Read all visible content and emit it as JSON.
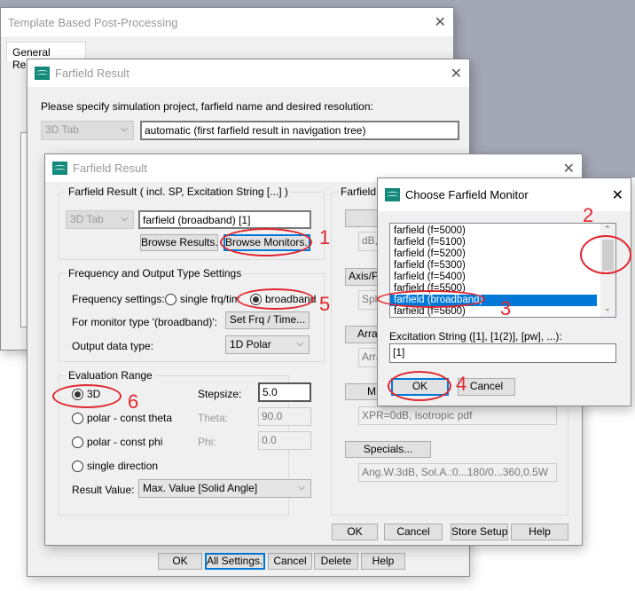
{
  "template_window": {
    "title": "Template Based Post-Processing",
    "tab": "General Results"
  },
  "farfield_back": {
    "title": "Farfield Result",
    "instruction": "Please specify simulation project, farfield name and desired resolution:",
    "combo": "3D Tab",
    "result_input": "automatic (first farfield result in navigation tree)",
    "buttons": {
      "ok": "OK",
      "all_settings": "All Settings...",
      "cancel": "Cancel",
      "delete": "Delete",
      "help": "Help"
    }
  },
  "farfield_front": {
    "title": "Farfield Result",
    "result_group": {
      "legend": "Farfield Result ( incl. SP, Excitation String [...] )",
      "combo": "3D Tab",
      "input": "farfield (broadband) [1]",
      "browse_results": "Browse Results...",
      "browse_monitors": "Browse Monitors..."
    },
    "freq_group": {
      "legend": "Frequency and Output Type Settings",
      "freq_label": "Frequency settings:",
      "radio_single": "single frq/time",
      "radio_broadband": "broadband",
      "monitor_type_label": "For monitor type '(broadband)':",
      "set_frq": "Set Frq / Time...",
      "output_label": "Output data type:",
      "output_value": "1D Polar"
    },
    "eval_group": {
      "legend": "Evaluation Range",
      "radio_3d": "3D",
      "radio_theta": "polar - const theta",
      "radio_phi": "polar - const phi",
      "radio_single": "single direction",
      "stepsize_label": "Stepsize:",
      "stepsize": "5.0",
      "theta_label": "Theta:",
      "theta": "90.0",
      "phi_label": "Phi:",
      "phi": "0.0",
      "result_value_label": "Result Value:",
      "result_value": "Max. Value [Solid Angle]"
    },
    "settings_group": {
      "legend": "Farfield S",
      "plot": "Plo",
      "plot_value": "dB,F",
      "axis": "Axis/P",
      "axis_value": "Sph",
      "array": "Arra",
      "array_value": "Arra",
      "m_button": "M",
      "xpr_value": "XPR=0dB, isotropic pdf",
      "specials": "Specials...",
      "specials_value": "Ang.W.3dB, Sol.A.:0...180/0...360,0.5W"
    },
    "buttons": {
      "ok": "OK",
      "cancel": "Cancel",
      "store_setup": "Store Setup",
      "help": "Help"
    }
  },
  "chooser": {
    "title": "Choose Farfield Monitor",
    "items": [
      "farfield (f=5000)",
      "farfield (f=5100)",
      "farfield (f=5200)",
      "farfield (f=5300)",
      "farfield (f=5400)",
      "farfield (f=5500)",
      "farfield (broadband)",
      "farfield (f=5600)"
    ],
    "selected": "farfield (broadband)",
    "excitation_label": "Excitation String ([1], [1(2)], [pw], ...):",
    "excitation_value": "[1]",
    "ok": "OK",
    "cancel": "Cancel"
  },
  "annotations": [
    "1",
    "2",
    "3",
    "4",
    "5",
    "6"
  ],
  "colors": {
    "accent": "#0078d7",
    "annotation": "#e0262d",
    "logo": "#12897a"
  }
}
